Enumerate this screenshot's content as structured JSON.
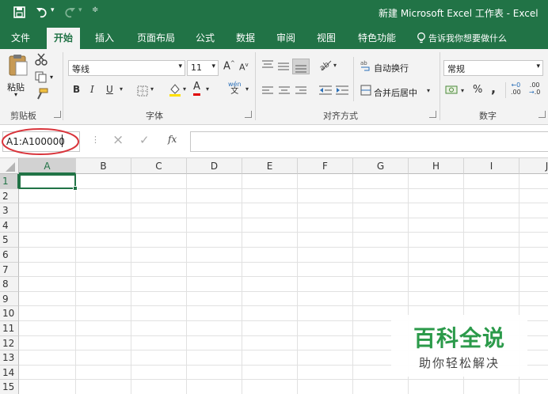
{
  "window": {
    "title": "新建 Microsoft Excel 工作表  -  Excel"
  },
  "menu_tabs": [
    "文件",
    "开始",
    "插入",
    "页面布局",
    "公式",
    "数据",
    "审阅",
    "视图",
    "特色功能"
  ],
  "tell_me": "告诉我你想要做什么",
  "ribbon": {
    "clipboard": {
      "paste": "粘贴",
      "label": "剪贴板"
    },
    "font": {
      "name": "等线",
      "size": "11",
      "bold": "B",
      "italic": "I",
      "underline": "U",
      "grow": "A",
      "shrink": "A",
      "wen": "wén",
      "label": "字体"
    },
    "alignment": {
      "wrap": "自动换行",
      "merge": "合并后居中",
      "label": "对齐方式"
    },
    "number": {
      "format": "常规",
      "percent": "%",
      "comma": ",",
      "inc_decimal": ".00",
      "dec_decimal": ".0",
      "label": "数字"
    }
  },
  "formula_bar": {
    "name_box": "A1:A100000",
    "cancel": "×",
    "enter": "✓",
    "fx": "fx",
    "value": ""
  },
  "sheet": {
    "columns": [
      "A",
      "B",
      "C",
      "D",
      "E",
      "F",
      "G",
      "H",
      "I",
      "J"
    ],
    "rows": [
      "1",
      "2",
      "3",
      "4",
      "5",
      "6",
      "7",
      "8",
      "9",
      "10",
      "11",
      "12",
      "13",
      "14",
      "15"
    ],
    "selected_cell": "A1"
  },
  "watermark": {
    "title": "百科全说",
    "subtitle": "助你轻松解决"
  },
  "colors": {
    "accent": "#217346",
    "annotation": "#d9343b",
    "watermark_title": "#2b9a4a"
  }
}
